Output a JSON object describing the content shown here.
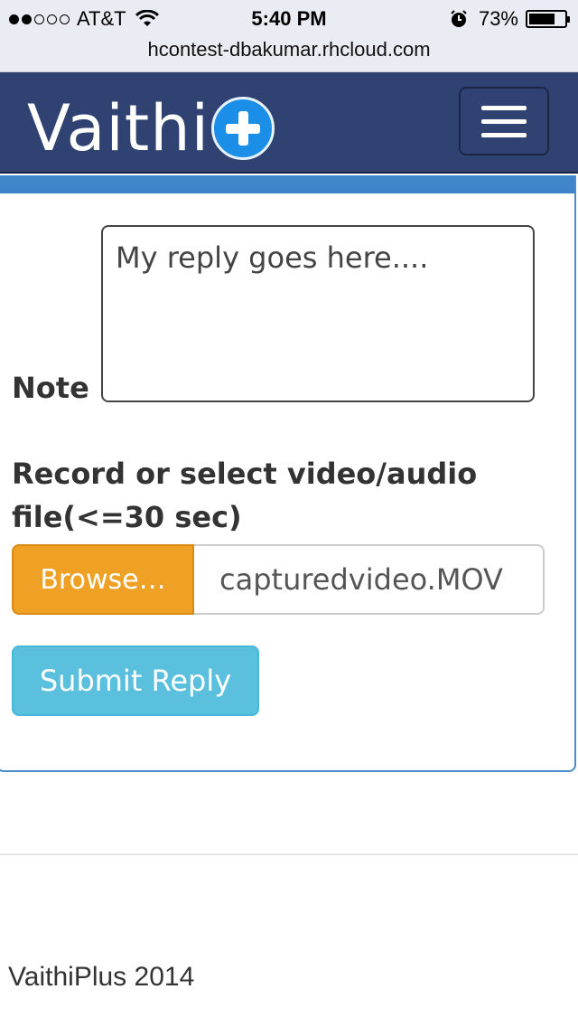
{
  "status_bar": {
    "carrier": "AT&T",
    "signal_bars_filled": 2,
    "signal_bars_total": 5,
    "time": "5:40 PM",
    "battery_percent": "73%",
    "battery_level": 0.73,
    "url": "hcontest-dbakumar.rhcloud.com",
    "icons": [
      "wifi-icon",
      "alarm-icon",
      "battery-icon"
    ]
  },
  "navbar": {
    "brand_text": "Vaithi",
    "brand_icon": "plus-icon",
    "menu_icon": "hamburger-menu-icon"
  },
  "form": {
    "note_label": "Note",
    "note_value": "My reply goes here....",
    "file_label": "Record or select video/audio file(<=30 sec)",
    "browse_label": "Browse…",
    "file_name": "capturedvideo.MOV",
    "submit_label": "Submit Reply"
  },
  "footer": {
    "text": "VaithiPlus 2014"
  },
  "colors": {
    "navbar": "#2f4272",
    "panel_heading": "#3e86c9",
    "browse": "#eea124",
    "submit": "#5bc0de",
    "brand_plus": "#1b8fe8"
  }
}
